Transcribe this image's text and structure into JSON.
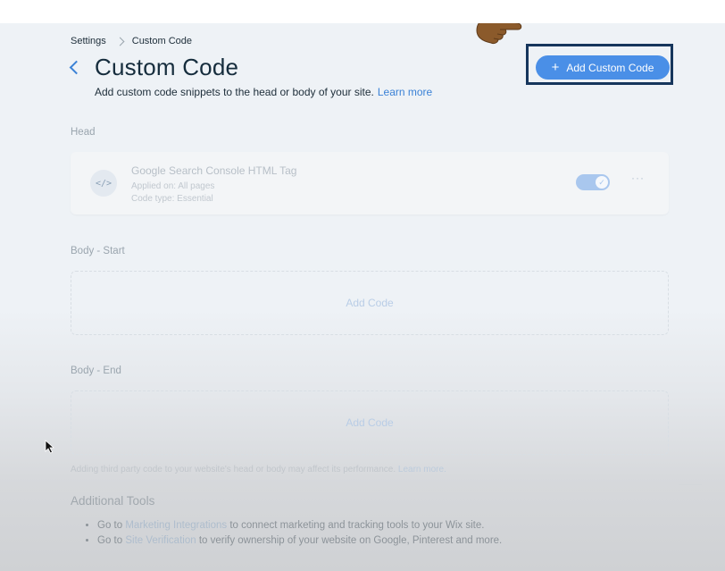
{
  "breadcrumb": {
    "parent": "Settings",
    "current": "Custom Code"
  },
  "header": {
    "title": "Custom Code",
    "subtitle": "Add custom code snippets to the head or body of your site.",
    "learn_more": "Learn more",
    "add_button": "Add Custom Code"
  },
  "head_section": {
    "label": "Head",
    "item": {
      "icon_text": "</>",
      "title": "Google Search Console HTML Tag",
      "applied_on": "Applied on: All pages",
      "code_type": "Code type: Essential",
      "enabled": true,
      "more": "···"
    }
  },
  "body_start": {
    "label": "Body - Start",
    "add_code": "Add Code"
  },
  "body_end": {
    "label": "Body - End",
    "add_code": "Add Code"
  },
  "notice": {
    "text": "Adding third party code to your website's head or body may affect its performance.",
    "link": "Learn more."
  },
  "additional_tools": {
    "title": "Additional Tools",
    "items": [
      {
        "prefix": "Go to",
        "link": "Marketing Integrations",
        "suffix": "to connect marketing and tracking tools to your Wix site."
      },
      {
        "prefix": "Go to",
        "link": "Site Verification",
        "suffix": "to verify ownership of your website on Google, Pinterest and more."
      }
    ]
  },
  "colors": {
    "accent": "#4a8fe7",
    "highlight_border": "#16365c",
    "title": "#162d3d",
    "hand": "#8b5a2b"
  },
  "icons": [
    "back-chevron-icon",
    "breadcrumb-chevron-icon",
    "plus-icon",
    "code-icon",
    "check-icon",
    "more-icon",
    "pointing-hand-icon",
    "mouse-cursor-icon"
  ]
}
